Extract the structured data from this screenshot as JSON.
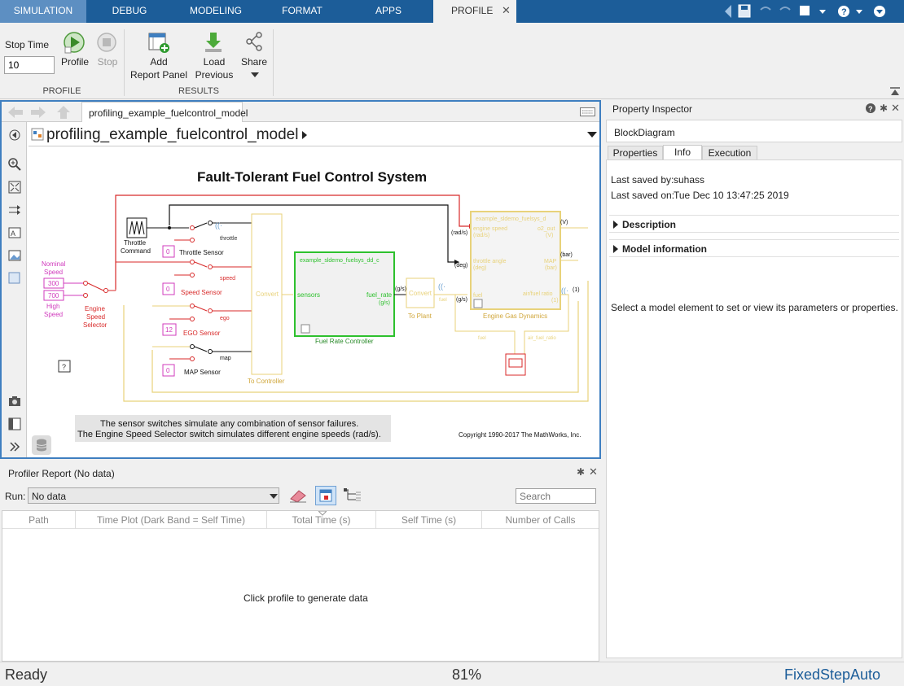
{
  "tabs": [
    {
      "label": "SIMULATION"
    },
    {
      "label": "DEBUG"
    },
    {
      "label": "MODELING"
    },
    {
      "label": "FORMAT"
    },
    {
      "label": "APPS"
    },
    {
      "label": "PROFILE"
    }
  ],
  "toolstrip": {
    "stop_time_label": "Stop Time",
    "stop_time_value": "10",
    "profile_label": "Profile",
    "stop_label": "Stop",
    "add_report_label_1": "Add",
    "add_report_label_2": "Report Panel",
    "load_previous_label_1": "Load",
    "load_previous_label_2": "Previous",
    "share_label": "Share",
    "section_profile": "PROFILE",
    "section_results": "RESULTS"
  },
  "canvas": {
    "doc_tab": "profiling_example_fuelcontrol_model",
    "address": "profiling_example_fuelcontrol_model",
    "title": "Fault-Tolerant Fuel Control System",
    "labels": {
      "nominal": "Nominal",
      "speed": "Speed",
      "high": "High",
      "high_speed": "Speed",
      "val300": "300",
      "val700": "700",
      "engine": "Engine",
      "speed2": "Speed",
      "selector": "Selector",
      "throttle": "Throttle",
      "command": "Command",
      "throttle_sensor": "Throttle Sensor",
      "speed_sensor": "Speed Sensor",
      "ego_sensor": "EGO Sensor",
      "map_sensor": "MAP Sensor",
      "zero1": "0",
      "zero2": "0",
      "twelve": "12",
      "zero3": "0",
      "sig_throttle": "throttle",
      "sig_speed": "speed",
      "sig_ego": "ego",
      "sig_map": "map",
      "convert": "Convert",
      "to_controller": "To Controller",
      "frc_ref": "example_sldemo_fuelsys_dd_c",
      "sensors": "sensors",
      "fuel_rate": "fuel_rate",
      "gs": "(g/s)",
      "frc_name": "Fuel Rate Controller",
      "gs2": "(g/s)",
      "convert2": "Convert",
      "to_plant": "To Plant",
      "fuel_small": "fuel",
      "gs3": "(g/s)",
      "egd_ref": "example_sldemo_fuelsys_d",
      "engine_speed": "engine speed",
      "rads": "(rad/s)",
      "rads_out": "(rad/s)",
      "throttle_angle": "throttle angle",
      "deg": "(deg)",
      "deg_out": "(deg)",
      "fuel_in": "fuel",
      "o2_out": "o2_out",
      "v": "(V)",
      "v_out": "(V)",
      "map_port": "MAP",
      "bar": "(bar)",
      "bar_out": "(bar)",
      "afr": "air/fuel ratio",
      "one": "(1)",
      "egd_name": "Engine Gas Dynamics",
      "fuel_lbl": "fuel",
      "afr_lbl": "air_fuel_ratio",
      "note_1": "The sensor switches simulate any combination of sensor failures.",
      "note_2": "The Engine Speed Selector switch simulates different engine speeds (rad/s).",
      "copyright": "Copyright 1990-2017 The MathWorks, Inc.",
      "help_mark": "?"
    }
  },
  "profiler": {
    "title": "Profiler Report (No data)",
    "run_label": "Run:",
    "run_value": "No data",
    "search_placeholder": "Search",
    "columns": [
      "Path",
      "Time Plot (Dark Band = Self Time)",
      "Total Time (s)",
      "Self Time (s)",
      "Number of Calls"
    ],
    "empty_message": "Click profile to generate data"
  },
  "inspector": {
    "title": "Property Inspector",
    "object": "BlockDiagram",
    "tabs": [
      "Properties",
      "Info",
      "Execution"
    ],
    "last_saved_by_label": "Last saved by:",
    "last_saved_by_value": "suhass",
    "last_saved_on_label": "Last saved on:",
    "last_saved_on_value": "Tue Dec 10 13:47:25 2019",
    "section_description": "Description",
    "section_model_info": "Model information",
    "hint": "Select a model element to set or view its parameters or properties."
  },
  "status": {
    "state": "Ready",
    "zoom": "81%",
    "solver": "FixedStepAuto"
  }
}
